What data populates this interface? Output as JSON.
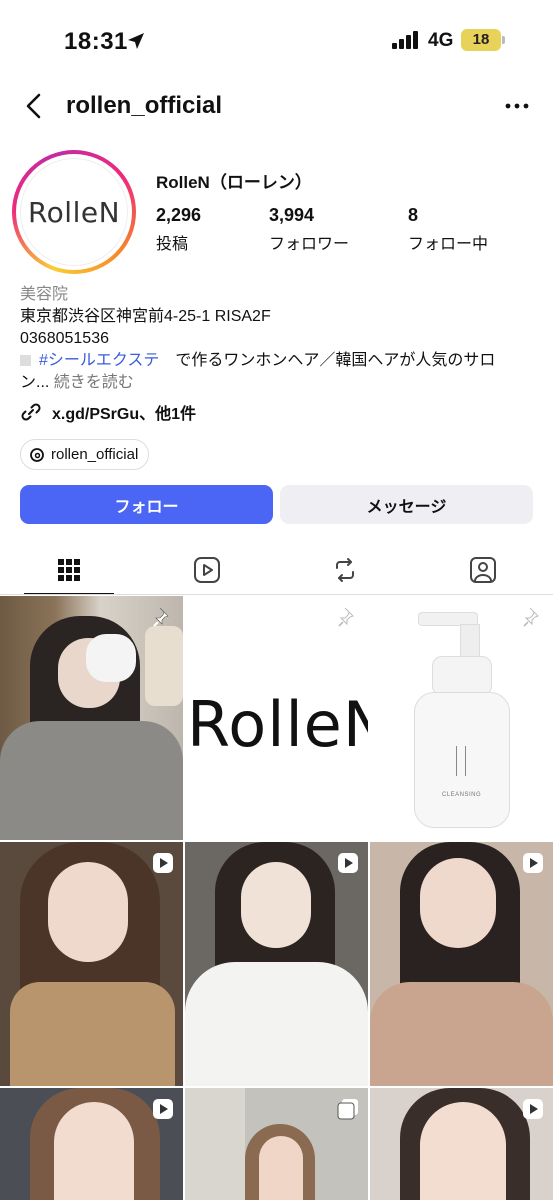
{
  "status_bar": {
    "time": "18:31",
    "network": "4G",
    "battery": "18"
  },
  "header": {
    "username": "rollen_official"
  },
  "profile": {
    "avatar_text": "RolleN",
    "display_name": "RolleN（ローレン）",
    "stats": [
      {
        "value": "2,296",
        "label": "投稿"
      },
      {
        "value": "3,994",
        "label": "フォロワー"
      },
      {
        "value": "8",
        "label": "フォロー中"
      }
    ],
    "bio": {
      "category": "美容院",
      "address": "東京都渋谷区神宮前4-25-1 RISA2F",
      "phone": "0368051536",
      "hashtag": "#シールエクステ",
      "text_after_hashtag": "　で作るワンホンヘア／韓国ヘアが人気のサロ",
      "text_continued": "ン...",
      "read_more": "続きを読む"
    },
    "link": "x.gd/PSrGu、他1件",
    "threads_handle": "rollen_official"
  },
  "actions": {
    "follow": "フォロー",
    "message": "メッセージ"
  },
  "tabs": [
    {
      "icon": "grid-icon",
      "active": true
    },
    {
      "icon": "reels-icon",
      "active": false
    },
    {
      "icon": "reposts-icon",
      "active": false
    },
    {
      "icon": "tagged-icon",
      "active": false
    }
  ],
  "grid_posts": [
    {
      "kind": "photo",
      "badge": "pin-icon",
      "note": "woman with mask mirror selfie"
    },
    {
      "kind": "logo",
      "text": "RolleN",
      "badge": "pin-icon"
    },
    {
      "kind": "product",
      "product_label": "CLEANSING",
      "badge": "pin-icon"
    },
    {
      "kind": "video",
      "badge": "reel-icon"
    },
    {
      "kind": "video",
      "badge": "reel-icon"
    },
    {
      "kind": "video",
      "badge": "reel-icon"
    },
    {
      "kind": "video",
      "badge": "reel-icon"
    },
    {
      "kind": "carousel",
      "badge": "carousel-icon"
    },
    {
      "kind": "video",
      "badge": "reel-icon"
    }
  ],
  "colors": {
    "follow_button": "#4b66f5",
    "hashtag": "#3b5bdb",
    "message_button": "#efeff3"
  }
}
